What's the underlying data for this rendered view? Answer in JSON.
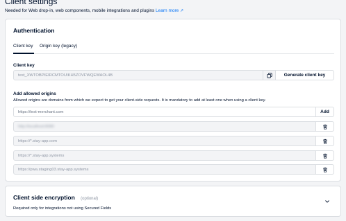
{
  "page": {
    "title": "Client settings",
    "subtitle": "Needed for Web drop-in, web components, mobile integrations and plugins",
    "learn_more": "Learn more",
    "learn_more_icon": "external-link-icon"
  },
  "authentication": {
    "heading": "Authentication",
    "tabs": [
      {
        "label": "Client key",
        "active": true
      },
      {
        "label": "Origin key (legacy)",
        "active": false
      }
    ],
    "client_key": {
      "label": "Client key",
      "value": "test_XWTOBPIEIRCMTOUIKH5ZOVFWQEWAOL4B",
      "copy_icon": "copy-icon",
      "generate_label": "Generate client key"
    },
    "allowed_origins": {
      "label": "Add allowed origins",
      "help": "Allowed origins are domains from which we expect to get your client-side requests. It is mandatory to add at least one when using a client key.",
      "input_placeholder": "https://test-merchant.com",
      "add_label": "Add",
      "delete_icon": "trash-icon",
      "origins": [
        {
          "value": "http://localhost:8080",
          "redacted": true
        },
        {
          "value": "https://*.stay-app.com",
          "redacted": false
        },
        {
          "value": "https://*.stay-app.systems",
          "redacted": false
        },
        {
          "value": "https://pwa.staging03.stay-app.systems",
          "redacted": false
        }
      ]
    }
  },
  "client_side_encryption": {
    "heading": "Client side encryption",
    "optional": "(optional)",
    "subtitle": "Required only for integrations not using Secured Fields",
    "expand_icon": "chevron-down-icon"
  },
  "colors": {
    "text": "#00112c",
    "link": "#0070f5",
    "border": "#dbdee2",
    "field_disabled": "#f3f4f6",
    "muted": "#8d95a3"
  }
}
